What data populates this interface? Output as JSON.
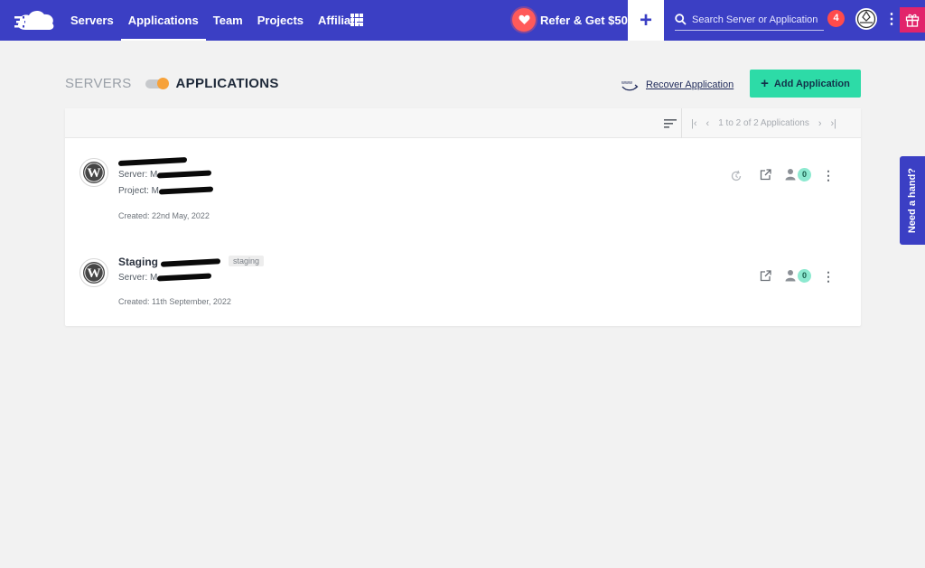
{
  "nav": {
    "items": [
      {
        "label": "Servers",
        "active": false
      },
      {
        "label": "Applications",
        "active": true
      },
      {
        "label": "Team",
        "active": false
      },
      {
        "label": "Projects",
        "active": false
      },
      {
        "label": "Affiliate",
        "active": false
      }
    ],
    "refer_label": "Refer & Get $50",
    "add_icon": "plus-icon",
    "search_placeholder": "Search Server or Application",
    "notification_count": "4"
  },
  "header": {
    "toggle_left": "SERVERS",
    "toggle_right": "APPLICATIONS",
    "recover_label": "Recover Application",
    "add_label": "Add Application"
  },
  "pager": {
    "summary": "1 to 2 of 2 Applications"
  },
  "apps": [
    {
      "name_prefix": "",
      "server_label": "Server:",
      "project_label": "Project:",
      "created": "Created: 22nd May, 2022",
      "user_count": "0"
    },
    {
      "name_prefix": "Staging",
      "tag": "staging",
      "server_label": "Server:",
      "created": "Created: 11th September, 2022",
      "user_count": "0"
    }
  ],
  "help_tab": "Need a hand?",
  "colors": {
    "brand": "#3b3fc4",
    "accent_green": "#2ddba7",
    "notification": "#ff4b4b",
    "toggle_knob": "#f7a23a",
    "gift": "#e2246b"
  }
}
